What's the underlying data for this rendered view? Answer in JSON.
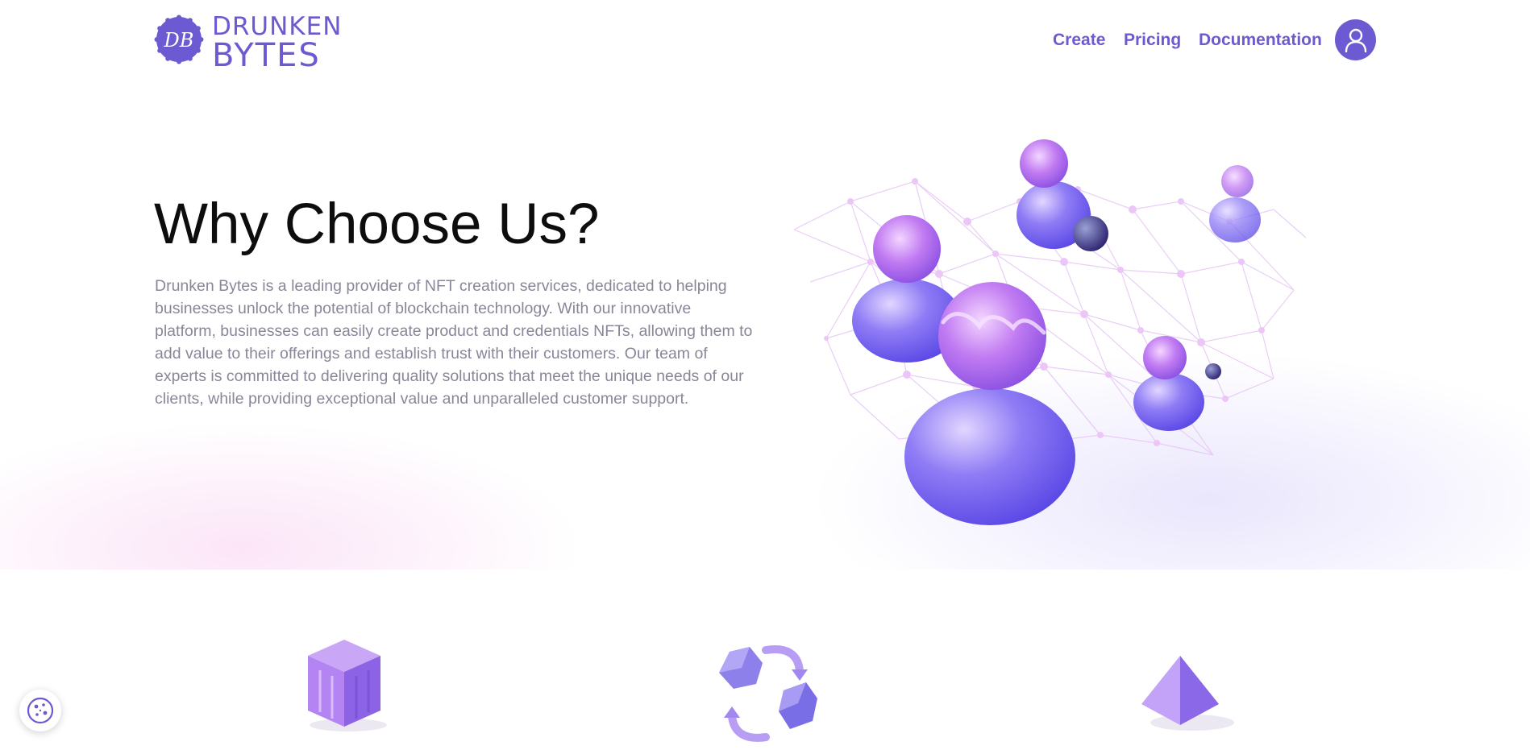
{
  "brand": {
    "monogram": "DB",
    "name_line1": "DRUNKEN",
    "name_line2": "BYTES",
    "color": "#6b5ad1"
  },
  "nav": {
    "items": [
      {
        "label": "Create"
      },
      {
        "label": "Pricing"
      },
      {
        "label": "Documentation"
      }
    ],
    "profile_icon": "user-icon"
  },
  "hero": {
    "title": "Why Choose Us?",
    "body": "Drunken Bytes is a leading provider of NFT creation services, dedicated to helping businesses unlock the potential of blockchain technology. With our innovative platform, businesses can easily create product and credentials NFTs, allowing them to add value to their offerings and establish trust with their customers. Our team of experts is committed to delivering quality solutions that meet the unique needs of our clients, while providing exceptional value and unparalleled customer support.",
    "illustration": "network-people-illustration"
  },
  "features": {
    "icons": [
      "cube-icon",
      "exchange-arrows-icon",
      "pyramid-icon"
    ]
  },
  "cookie": {
    "icon": "cookie-icon"
  },
  "colors": {
    "accent": "#6b5ad1",
    "title_text": "#0d0d0d",
    "body_text": "#8a8699"
  }
}
